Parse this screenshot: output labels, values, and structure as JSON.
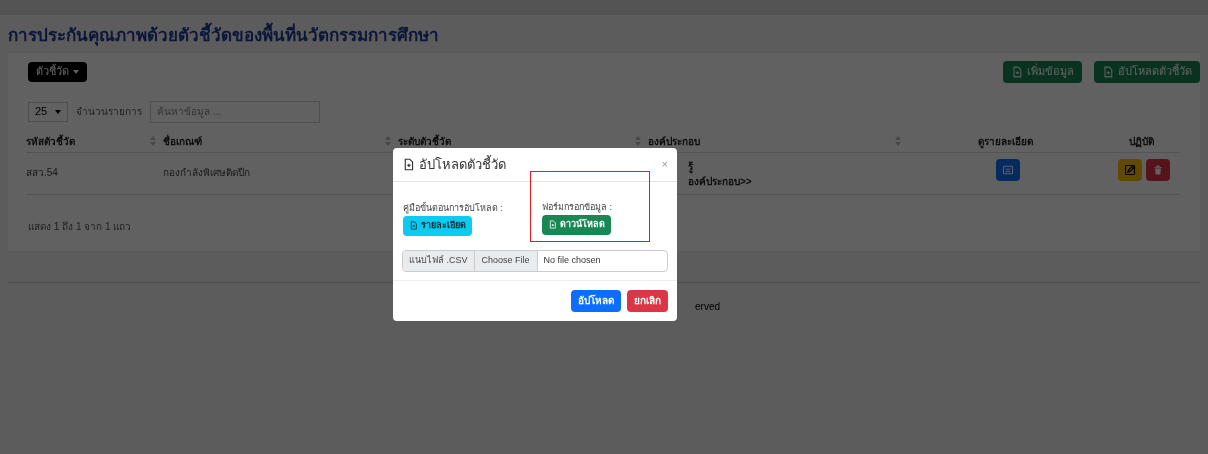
{
  "page_title": "การประกันคุณภาพด้วยตัวชี้วัดของพื้นที่นวัตกรรมการศึกษา",
  "menu_button": {
    "label": "ตัวชี้วัด"
  },
  "toolbar_buttons": [
    {
      "label": "เพิ่มข้อมูล"
    },
    {
      "label": "อัปโหลดตัวชี้วัด"
    }
  ],
  "page_size": {
    "value": "25",
    "label": "จำนวนรายการ"
  },
  "search": {
    "placeholder": "ค้นหาข้อมูล ..."
  },
  "table": {
    "columns": [
      {
        "label": "รหัสตัวชี้วัด",
        "kind": "sortable"
      },
      {
        "label": "ชื่อเกณฑ์",
        "kind": "sortable"
      },
      {
        "label": "ระดับตัวชี้วัด",
        "kind": "sortable"
      },
      {
        "label": "องค์ประกอบ",
        "kind": "sortable"
      },
      {
        "label": "ดูรายละเอียด",
        "kind": "centered"
      },
      {
        "label": "ปฏิบัติ",
        "kind": "centered"
      }
    ],
    "rows": [
      {
        "code": "สสว.54",
        "name": "กองกำลังพิเศษติดปีก",
        "component_lines": [
          "รู้",
          "องค์ประกอบ>>"
        ]
      }
    ]
  },
  "table_info": "แสดง 1 ถึง 1 จาก 1 แถว",
  "footer_fragment": "erved",
  "modal": {
    "title": "อัปโหลดตัวชี้วัด",
    "close": "×",
    "sections": [
      {
        "label": "คู่มือขั้นตอนการอัปโหลด :",
        "button": "รายละเอียด",
        "kind": "info",
        "highlighted": false
      },
      {
        "label": "ฟอร์มกรอกข้อมูล :",
        "button": "ดาวน์โหลด",
        "kind": "success",
        "highlighted": true
      }
    ],
    "file_input": {
      "addon": "แนบไฟล์ .CSV",
      "button": "Choose File",
      "status": "No file chosen"
    },
    "buttons": [
      {
        "label": "อัปโหลด",
        "kind": "primary"
      },
      {
        "label": "ยกเลิก",
        "kind": "danger"
      }
    ]
  }
}
